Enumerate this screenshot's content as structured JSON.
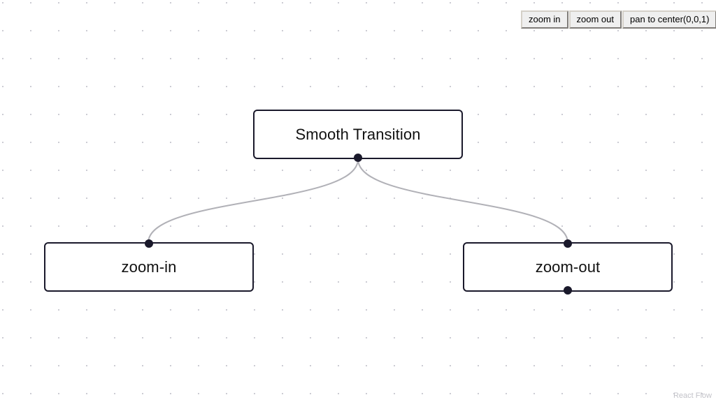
{
  "panel": {
    "buttons": [
      {
        "label": "zoom in",
        "name": "zoom-in-button"
      },
      {
        "label": "zoom out",
        "name": "zoom-out-button"
      },
      {
        "label": "pan to center(0,0,1)",
        "name": "pan-to-center-button"
      }
    ]
  },
  "nodes": [
    {
      "id": "smooth-transition",
      "label": "Smooth Transition"
    },
    {
      "id": "zoom-in",
      "label": "zoom-in"
    },
    {
      "id": "zoom-out",
      "label": "zoom-out"
    }
  ],
  "attribution": {
    "label": "React Flow"
  },
  "colors": {
    "node_border": "#1a192b",
    "handle": "#1a192b",
    "edge": "#b1b1b7",
    "background_dot": "#c8c8d0",
    "canvas": "#ffffff",
    "attribution_text": "#c2c2c8"
  }
}
